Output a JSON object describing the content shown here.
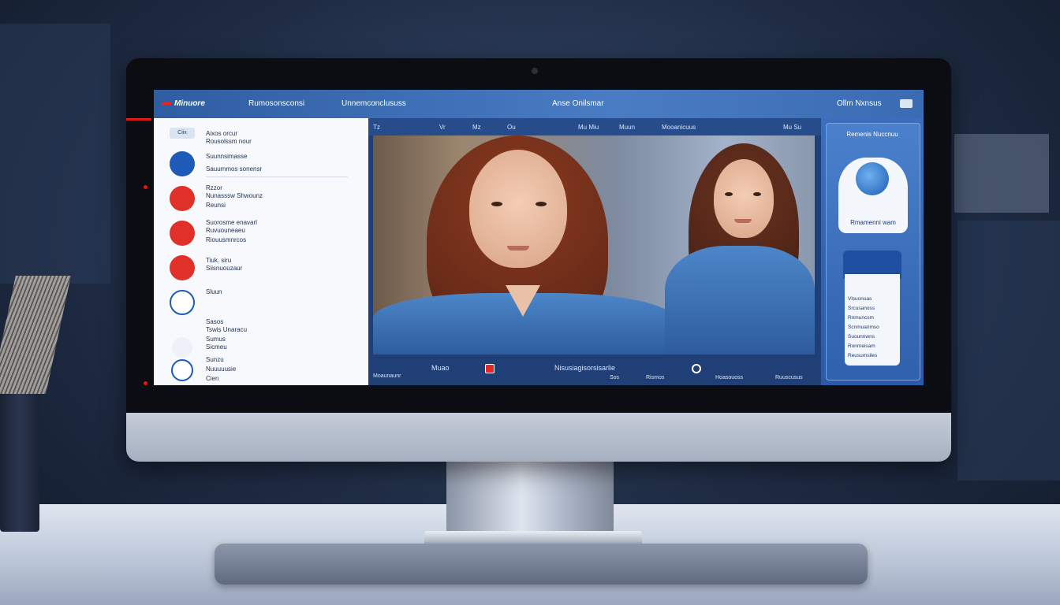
{
  "app": {
    "name": "Minuore",
    "nav_1": "Rumosonsconsi",
    "nav_2": "Unnemconclususs",
    "center_title": "Anse Onilsmar",
    "right_label": "Ollm Nxnsus"
  },
  "sidebar": {
    "search_label": "Ciix",
    "items": [
      {
        "line1": "Aixos orcur",
        "line2": "Rousolssm nour",
        "line3": ""
      },
      {
        "line1": "Suunnsimasse",
        "line2": "Sauummos sonensr",
        "line3": ""
      },
      {
        "line1": "Rzzor",
        "line2": "Nunasssw Shwounz",
        "line3": "Reunsi"
      },
      {
        "line1": "Suorosme enavarl",
        "line2": "Ruvuouneaeu",
        "line3": "Riouusmnrcos"
      },
      {
        "line1": "Tiuk. siru",
        "line2": "Siisnuouzaur",
        "line3": ""
      },
      {
        "line1": "Sluun",
        "line2": "",
        "line3": ""
      },
      {
        "line1": "Sasos",
        "line2": "Tswis Unaracu",
        "line3": ""
      },
      {
        "line1": "Sumus",
        "line2": "Sicmeu",
        "line3": ""
      },
      {
        "line1": "Sunzu",
        "line2": "Nuuuuusie",
        "line3": "Cien"
      }
    ],
    "icon_colors": [
      "#1e5bb8",
      "#e0302a",
      "#e0302a",
      "#e0302a",
      "#ffffff",
      "#ffffff",
      "#ffffff"
    ]
  },
  "video": {
    "top_labels": [
      "Tz",
      "Vr",
      "Mz",
      "Ou",
      "Mu Miu",
      "Muun",
      "Mooanicuus",
      "Mu Su"
    ],
    "bottom_left": "Moaunaunr",
    "bottom_button": "Muao",
    "bottom_center": "Nisusiagisorsisarlie",
    "bottom_labels": [
      "Sos",
      "Rismos",
      "Hoasouoss",
      "Ruuscusus"
    ]
  },
  "right_panel": {
    "title": "Remenis Nuccnuu",
    "bubble_text": "Rmamenni wam",
    "note_lines": [
      "Vlsuonuas",
      "Srcusanoss",
      "Rnmuncsm",
      "Scnmuanmso",
      "Suounnwns",
      "Ronmeisam",
      "Reusumsiles"
    ]
  },
  "colors": {
    "accent": "#2f5da3",
    "alert": "#e01818"
  }
}
